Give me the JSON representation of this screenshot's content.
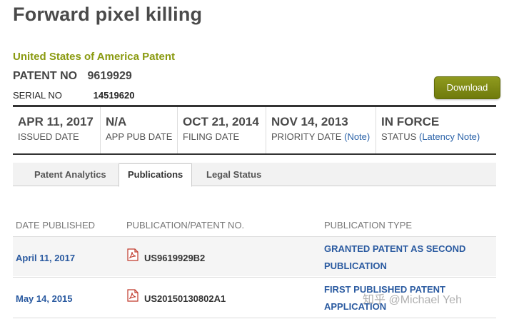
{
  "page": {
    "title": "Forward pixel killing",
    "origin": "United States of America Patent"
  },
  "patent": {
    "patent_no_label": "PATENT NO",
    "patent_no": "9619929",
    "serial_no_label": "SERIAL NO",
    "serial_no": "14519620"
  },
  "download_label": "Download",
  "dates": [
    {
      "value": "APR 11, 2017",
      "label": "ISSUED DATE",
      "note": ""
    },
    {
      "value": "N/A",
      "label": "APP PUB DATE",
      "note": ""
    },
    {
      "value": "OCT 21, 2014",
      "label": "FILING DATE",
      "note": ""
    },
    {
      "value": "NOV 14, 2013",
      "label": "PRIORITY DATE",
      "note": "(Note)"
    },
    {
      "value": "IN FORCE",
      "label": "STATUS",
      "note": "(Latency Note)"
    }
  ],
  "tabs": [
    "Patent Analytics",
    "Publications",
    "Legal Status"
  ],
  "active_tab": "Publications",
  "table": {
    "headers": [
      "DATE PUBLISHED",
      "PUBLICATION/PATENT NO.",
      "PUBLICATION TYPE"
    ],
    "rows": [
      {
        "date": "April 11, 2017",
        "number": "US9619929B2",
        "type_line1": "GRANTED PATENT AS SECOND",
        "type_line2": "PUBLICATION"
      },
      {
        "date": "May 14, 2015",
        "number": "US20150130802A1",
        "type_line1": "FIRST PUBLISHED PATENT",
        "type_line2": "APPLICATION"
      }
    ]
  },
  "watermark": "知乎 @Michael Yeh",
  "colors": {
    "accent_green": "#8a9a10",
    "link_blue": "#2a5aa0",
    "button_green": "#7f8a14"
  },
  "icons": {
    "pdf": "pdf-icon"
  }
}
